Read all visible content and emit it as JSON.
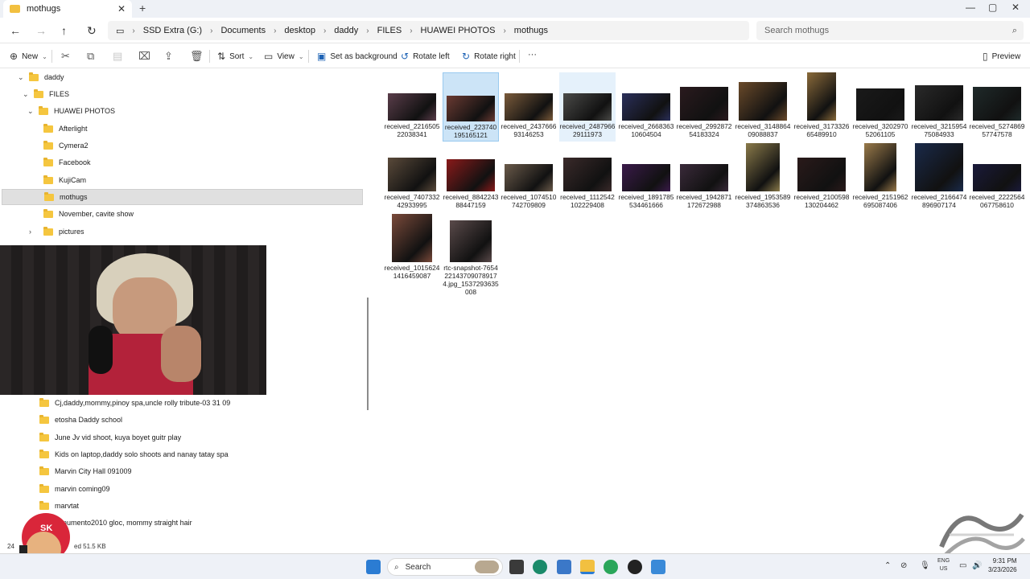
{
  "tab": {
    "title": "mothugs",
    "close_glyph": "✕",
    "new_glyph": "+"
  },
  "window_controls": {
    "minimize": "—",
    "maximize": "▢",
    "close": "✕"
  },
  "nav": {
    "back": "←",
    "forward": "→",
    "up": "↑",
    "refresh": "↻"
  },
  "breadcrumbs": [
    "SSD Extra (G:)",
    "Documents",
    "desktop",
    "daddy",
    "FILES",
    "HUAWEI PHOTOS",
    "mothugs"
  ],
  "search": {
    "placeholder": "Search mothugs"
  },
  "toolbar": {
    "new": "New",
    "sort": "Sort",
    "view": "View",
    "set_background": "Set as background",
    "rotate_left": "Rotate left",
    "rotate_right": "Rotate right",
    "more": "···",
    "preview": "Preview"
  },
  "tree": [
    {
      "label": "daddy",
      "chev": "⌄"
    },
    {
      "label": "FILES",
      "chev": "⌄"
    },
    {
      "label": "HUAWEI PHOTOS",
      "chev": "⌄"
    },
    {
      "label": "Afterlight",
      "chev": ""
    },
    {
      "label": "Cymera2",
      "chev": ""
    },
    {
      "label": "Facebook",
      "chev": ""
    },
    {
      "label": "KujiCam",
      "chev": ""
    },
    {
      "label": "mothugs",
      "chev": ""
    },
    {
      "label": "November, cavite show",
      "chev": ""
    },
    {
      "label": "pictures",
      "chev": "›"
    },
    {
      "label": "Cj,daddy,mommy,pinoy spa,uncle rolly tribute-03 31 09",
      "chev": ""
    },
    {
      "label": "etosha Daddy school",
      "chev": ""
    },
    {
      "label": "June Jv vid shoot, kuya boyet guitr play",
      "chev": ""
    },
    {
      "label": "Kids on laptop,daddy solo shoots and nanay tatay spa",
      "chev": ""
    },
    {
      "label": "Marvin City Hall 091009",
      "chev": ""
    },
    {
      "label": "marvin coming09",
      "chev": ""
    },
    {
      "label": "marvtat",
      "chev": ""
    },
    {
      "label": "nonumento2010 gloc, mommy straight hair",
      "chev": ""
    }
  ],
  "files": [
    {
      "name": "received_221650522038341",
      "color": "#5a3d4a"
    },
    {
      "name": "received_223740195165121",
      "color": "#6a3a32"
    },
    {
      "name": "received_243766693146253",
      "color": "#7a5a3a"
    },
    {
      "name": "received_248796629111973",
      "color": "#4a4a48"
    },
    {
      "name": "received_266836310604504",
      "color": "#2a2f5a"
    },
    {
      "name": "received_299287254183324",
      "color": "#2a1a1e"
    },
    {
      "name": "received_314886409088837",
      "color": "#6a4a2a"
    },
    {
      "name": "received_317332665489910",
      "color": "#8a6a3a"
    },
    {
      "name": "received_320297052061105",
      "color": "#1a1a1a"
    },
    {
      "name": "received_321595475084933",
      "color": "#2a2a2a"
    },
    {
      "name": "received_527486957747578",
      "color": "#1f2a2a"
    },
    {
      "name": "received_740733242933995",
      "color": "#5a4a3a"
    },
    {
      "name": "received_884224388447159",
      "color": "#8a1a1a"
    },
    {
      "name": "received_1074510742709809",
      "color": "#6a5a4a"
    },
    {
      "name": "received_1112542102229408",
      "color": "#3a2a2a"
    },
    {
      "name": "received_1891785534461666",
      "color": "#3a1a4a"
    },
    {
      "name": "received_1942871172672988",
      "color": "#3a2a3a"
    },
    {
      "name": "received_1953589374863536",
      "color": "#8a7a4a"
    },
    {
      "name": "received_2100598130204462",
      "color": "#2a1a1a"
    },
    {
      "name": "received_2151962695087406",
      "color": "#9a7a4a"
    },
    {
      "name": "received_2166474896907174",
      "color": "#1a2a4a"
    },
    {
      "name": "received_2222564067758610",
      "color": "#1a1a3a"
    },
    {
      "name": "received_10156241416459087",
      "color": "#7a4a3a"
    },
    {
      "name": "rtc-snapshot-7654221437090789174.jpg_1537293635008",
      "color": "#5a4a4a"
    }
  ],
  "status": {
    "count": "24",
    "selected_text": "ed  51.5 KB"
  },
  "taskbar": {
    "search_label": "Search",
    "lang_top": "ENG",
    "lang_bottom": "US",
    "time": "9:31 PM",
    "date": "3/23/2026"
  },
  "overlay": {
    "sticker_text": "SK"
  }
}
